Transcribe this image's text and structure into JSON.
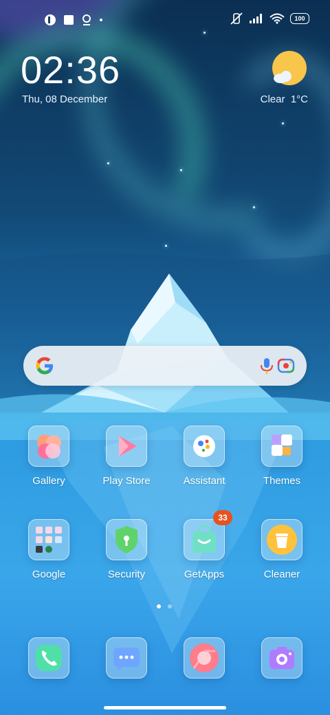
{
  "status_bar": {
    "left_icons": [
      "app-notification-icon",
      "square-notification-icon",
      "location-pin-icon",
      "dot-icon"
    ],
    "right_icons": [
      "vibrate-off-icon",
      "signal-icon",
      "wifi-icon",
      "battery-icon"
    ],
    "battery_level": "100"
  },
  "lockclock": {
    "time": "02:36",
    "date": "Thu, 08 December"
  },
  "weather": {
    "condition": "Clear",
    "temperature": "1°C",
    "icon": "sun-cloud-icon"
  },
  "search_bar": {
    "icons": [
      "google-logo-icon",
      "microphone-icon",
      "google-lens-icon"
    ]
  },
  "apps": {
    "row1": [
      {
        "label": "Gallery",
        "icon": "gallery-icon"
      },
      {
        "label": "Play Store",
        "icon": "play-store-icon"
      },
      {
        "label": "Assistant",
        "icon": "assistant-icon"
      },
      {
        "label": "Themes",
        "icon": "themes-icon"
      }
    ],
    "row2": [
      {
        "label": "Google",
        "icon": "google-folder-icon"
      },
      {
        "label": "Security",
        "icon": "security-icon"
      },
      {
        "label": "GetApps",
        "icon": "getapps-icon",
        "badge": "33"
      },
      {
        "label": "Cleaner",
        "icon": "cleaner-icon"
      }
    ]
  },
  "page_indicator": {
    "pages": 2,
    "active": 1
  },
  "dock": [
    {
      "icon": "phone-icon"
    },
    {
      "icon": "messages-icon"
    },
    {
      "icon": "browser-icon"
    },
    {
      "icon": "camera-icon"
    }
  ],
  "colors": {
    "badge": "#e7521f",
    "sky_top": "#0b2f52",
    "water": "#3aa6ea"
  }
}
